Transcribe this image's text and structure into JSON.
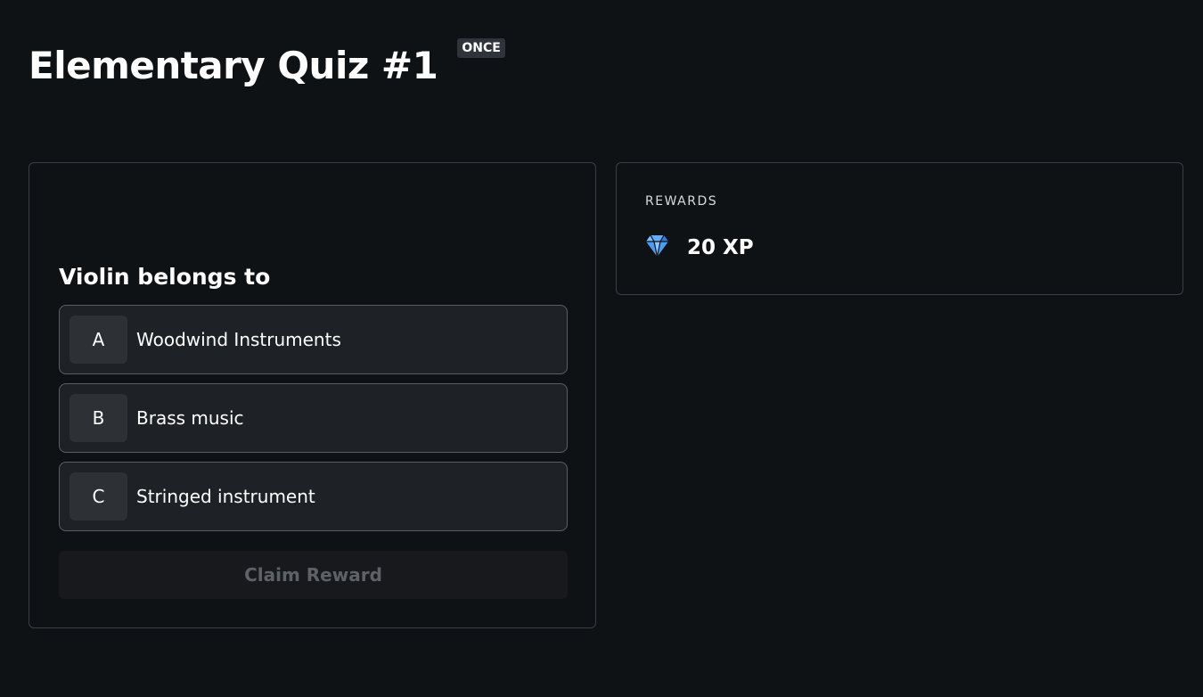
{
  "quiz": {
    "title": "Elementary Quiz #1",
    "frequency_badge": "ONCE",
    "question": "Violin belongs to",
    "options": [
      {
        "letter": "A",
        "text": "Woodwind Instruments"
      },
      {
        "letter": "B",
        "text": "Brass music"
      },
      {
        "letter": "C",
        "text": "Stringed instrument"
      }
    ],
    "claim_label": "Claim Reward"
  },
  "rewards": {
    "heading": "REWARDS",
    "items": [
      {
        "icon": "diamond-icon",
        "amount": "20 XP",
        "color": "#4a9df5"
      }
    ]
  },
  "colors": {
    "background": "#0f1215",
    "option_bg": "#1e2125",
    "letter_bg": "#2d3035",
    "disabled_button_bg": "#17191c",
    "disabled_button_text": "#5e6268",
    "badge_bg": "#30343a",
    "border": "#3a3f45",
    "accent_diamond": "#4a9df5"
  }
}
